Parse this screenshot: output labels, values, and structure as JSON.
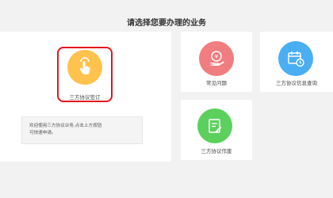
{
  "page": {
    "title": "请选择您要办理的业务"
  },
  "services": {
    "sign": {
      "label": "三方协议签订",
      "icon": "hand-tap-icon",
      "color": "#ffc24d"
    },
    "faq": {
      "label": "常见问题",
      "icon": "money-hand-icon",
      "color": "#f07d7f"
    },
    "query": {
      "label": "三方协议信息查询",
      "icon": "calendar-clock-icon",
      "color": "#4aaef3"
    },
    "cancel": {
      "label": "三方协议作废",
      "icon": "document-edit-icon",
      "color": "#5cd05c"
    }
  },
  "hint": {
    "line1": "欢迎使用三方协议业务,点击上方按钮",
    "line2": "可快速申请。"
  }
}
